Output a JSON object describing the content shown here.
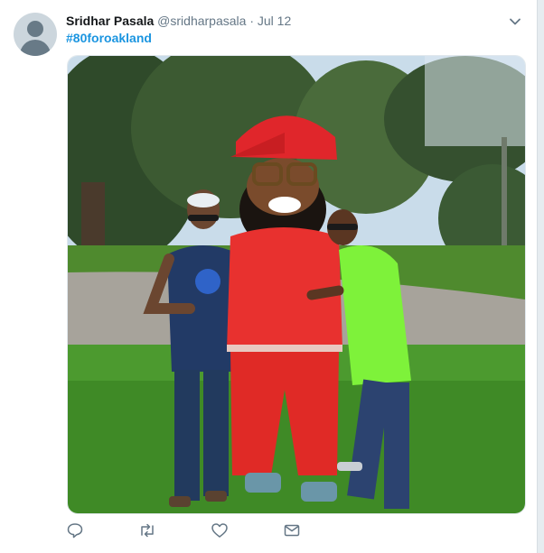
{
  "tweet": {
    "author_name": "Sridhar Pasala",
    "handle": "@sridharpasala",
    "separator": "·",
    "date": "Jul 12",
    "hashtag": "#80foroakland"
  },
  "media": {
    "icons": [
      "default-avatar-icon",
      "chevron-down-icon"
    ]
  },
  "actions": {
    "icons": [
      "reply-icon",
      "retweet-icon",
      "like-icon",
      "direct-message-icon"
    ]
  },
  "colors": {
    "hashtag": "#1b95e0",
    "meta_text": "#657786",
    "name_text": "#14171a"
  }
}
